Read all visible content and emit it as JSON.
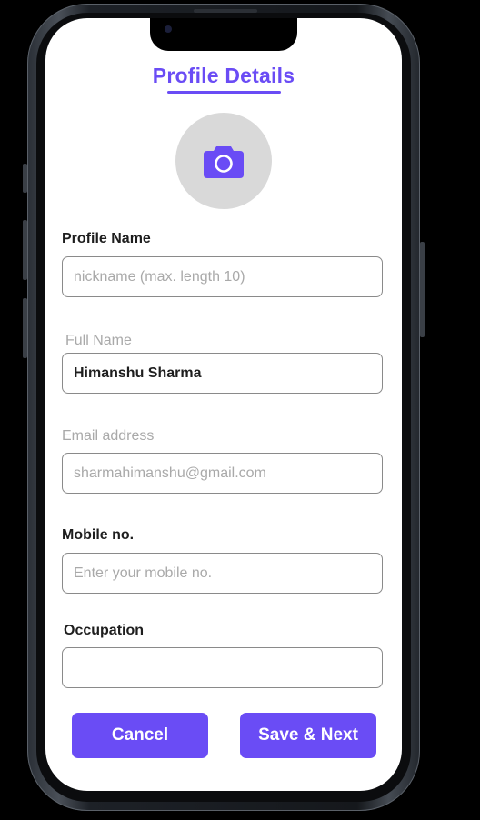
{
  "header": {
    "title": "Profile Details"
  },
  "avatar": {
    "icon": "camera-icon"
  },
  "form": {
    "profile_name": {
      "label": "Profile Name",
      "value": "",
      "placeholder": "nickname (max. length 10)"
    },
    "full_name": {
      "label": "Full Name",
      "value": "Himanshu Sharma",
      "placeholder": ""
    },
    "email": {
      "label": "Email address",
      "value": "",
      "placeholder": "sharmahimanshu@gmail.com"
    },
    "mobile": {
      "label": "Mobile no.",
      "value": "",
      "placeholder": "Enter your mobile no."
    },
    "occupation": {
      "label": "Occupation",
      "value": "",
      "placeholder": ""
    }
  },
  "actions": {
    "cancel_label": "Cancel",
    "save_label": "Save & Next"
  },
  "colors": {
    "accent": "#6a4cf5",
    "avatar_bg": "#d9d9d9",
    "muted_text": "#a9a9a9",
    "border": "#8a8a8a"
  }
}
